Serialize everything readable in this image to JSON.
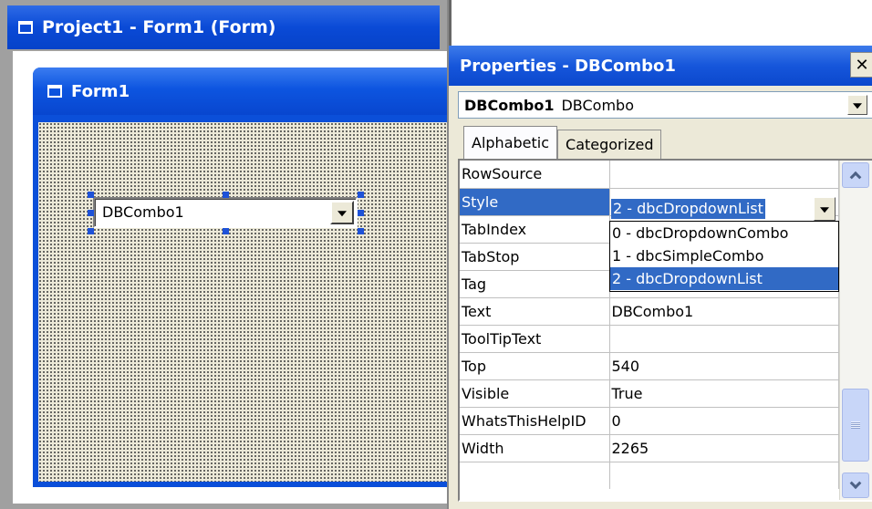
{
  "designer": {
    "title": "Project1 - Form1 (Form)",
    "form_title": "Form1",
    "control_text": "DBCombo1"
  },
  "properties": {
    "title": "Properties - DBCombo1",
    "close_glyph": "✕",
    "object_name": "DBCombo1",
    "object_type": "DBCombo",
    "tabs": [
      {
        "label": "Alphabetic",
        "active": true
      },
      {
        "label": "Categorized",
        "active": false
      }
    ],
    "rows": [
      {
        "name": "RowSource",
        "value": ""
      },
      {
        "name": "Style",
        "value": "2 - dbcDropdownList"
      },
      {
        "name": "TabIndex",
        "value": ""
      },
      {
        "name": "TabStop",
        "value": ""
      },
      {
        "name": "Tag",
        "value": ""
      },
      {
        "name": "Text",
        "value": "DBCombo1"
      },
      {
        "name": "ToolTipText",
        "value": ""
      },
      {
        "name": "Top",
        "value": "540"
      },
      {
        "name": "Visible",
        "value": "True"
      },
      {
        "name": "WhatsThisHelpID",
        "value": "0"
      },
      {
        "name": "Width",
        "value": "2265"
      }
    ],
    "selected_row": "Style",
    "style_options": [
      "0 - dbcDropdownCombo",
      "1 - dbcSimpleCombo",
      "2 - dbcDropdownList"
    ],
    "selected_option": "2 - dbcDropdownList"
  },
  "colors": {
    "titlebar": "#0a4ad6",
    "selection": "#316ac5",
    "handle": "#1e52d8"
  }
}
